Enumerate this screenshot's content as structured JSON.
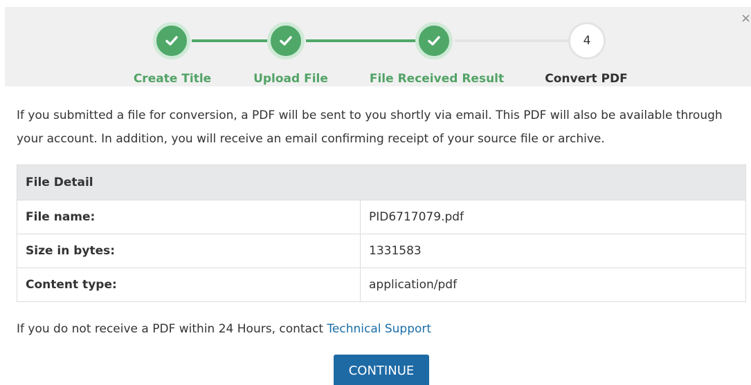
{
  "wizard": {
    "steps": [
      {
        "label": "Create Title",
        "state": "complete"
      },
      {
        "label": "Upload File",
        "state": "complete"
      },
      {
        "label": "File Received Result",
        "state": "complete"
      },
      {
        "label": "Convert PDF",
        "state": "pending",
        "number": "4"
      }
    ],
    "close_label": "×",
    "icons": {
      "complete": "check-icon"
    },
    "colors": {
      "complete": "#4fa868",
      "complete_text": "#52a366",
      "pending_line": "#e4e4e4"
    }
  },
  "main": {
    "intro": "If you submitted a file for conversion, a PDF will be sent to you shortly via email. This PDF will also be available through your account. In addition, you will receive an email confirming receipt of your source file or archive.",
    "file_detail": {
      "header": "File Detail",
      "rows": [
        {
          "label": "File name:",
          "value": "PID6717079.pdf"
        },
        {
          "label": "Size in bytes:",
          "value": "1331583"
        },
        {
          "label": "Content type:",
          "value": "application/pdf"
        }
      ]
    },
    "support_note": "If you do not receive a PDF within 24 Hours, contact ",
    "support_link": "Technical Support",
    "continue_label": "CONTINUE",
    "colors": {
      "link": "#1a6ea8",
      "button": "#1e6aa5"
    }
  }
}
